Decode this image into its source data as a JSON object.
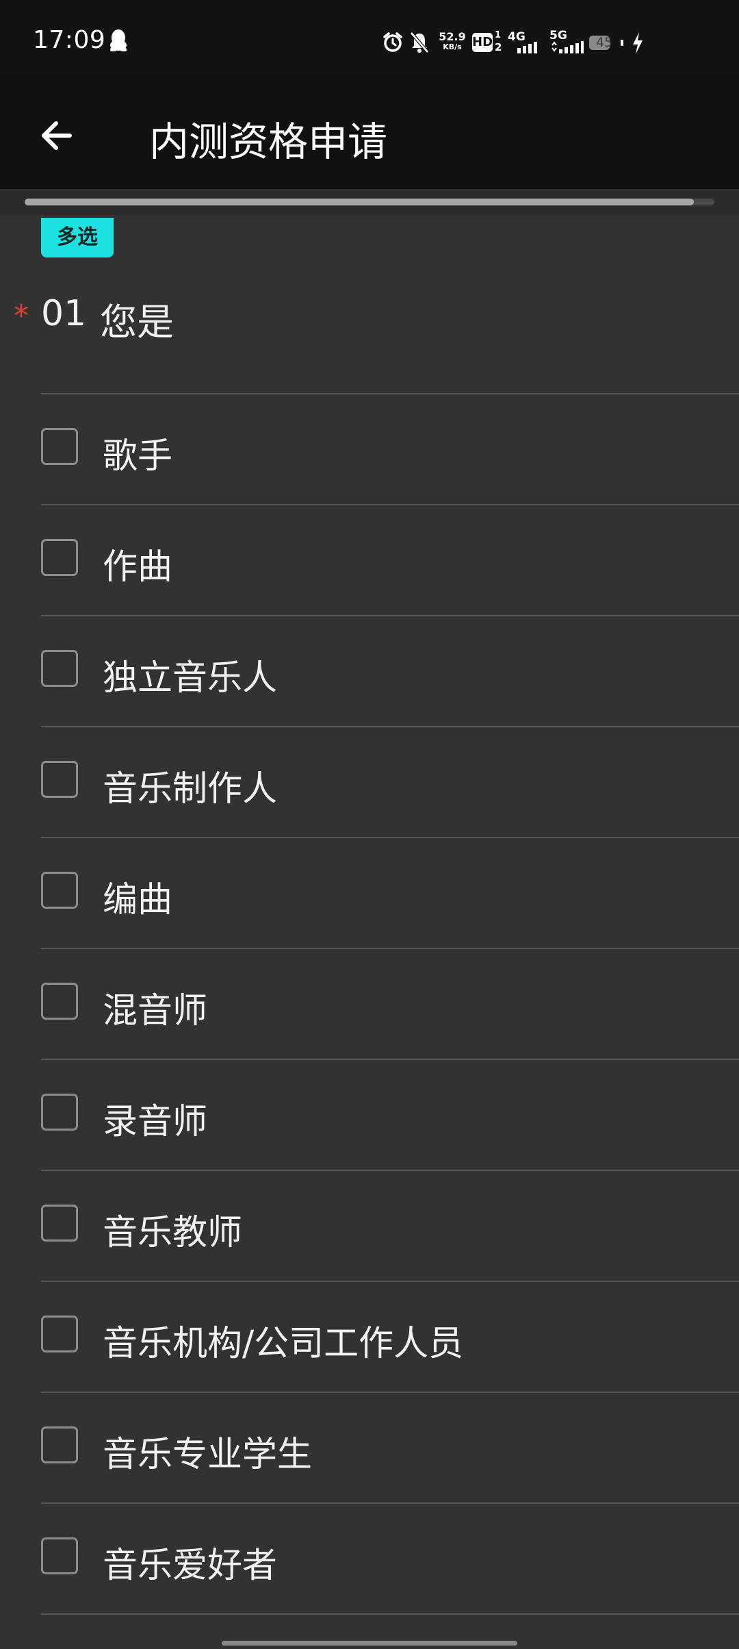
{
  "status_bar": {
    "time": "17:09",
    "net_speed_value": "52.9",
    "net_speed_unit": "KB/s",
    "hd_label": "HD",
    "sim1_label": "4G",
    "sim2_label": "5G",
    "battery_level": "45",
    "icons": [
      "qq-icon",
      "alarm-icon",
      "mute-icon",
      "hd-icon",
      "signal-icon",
      "battery-icon",
      "charging-icon"
    ]
  },
  "app_bar": {
    "title": "内测资格申请",
    "back_icon": "arrow-left-icon"
  },
  "progress": {
    "fraction": 0.97
  },
  "question": {
    "type_badge": "多选",
    "required_mark": "*",
    "number": "01",
    "text": "您是",
    "options": [
      {
        "label": "歌手",
        "checked": false
      },
      {
        "label": "作曲",
        "checked": false
      },
      {
        "label": "独立音乐人",
        "checked": false
      },
      {
        "label": "音乐制作人",
        "checked": false
      },
      {
        "label": "编曲",
        "checked": false
      },
      {
        "label": "混音师",
        "checked": false
      },
      {
        "label": "录音师",
        "checked": false
      },
      {
        "label": "音乐教师",
        "checked": false
      },
      {
        "label": "音乐机构/公司工作人员",
        "checked": false
      },
      {
        "label": "音乐专业学生",
        "checked": false
      },
      {
        "label": "音乐爱好者",
        "checked": false
      }
    ]
  },
  "colors": {
    "background": "#323232",
    "app_bar": "#111111",
    "badge": "#1de0e0",
    "required": "#e0403a"
  }
}
